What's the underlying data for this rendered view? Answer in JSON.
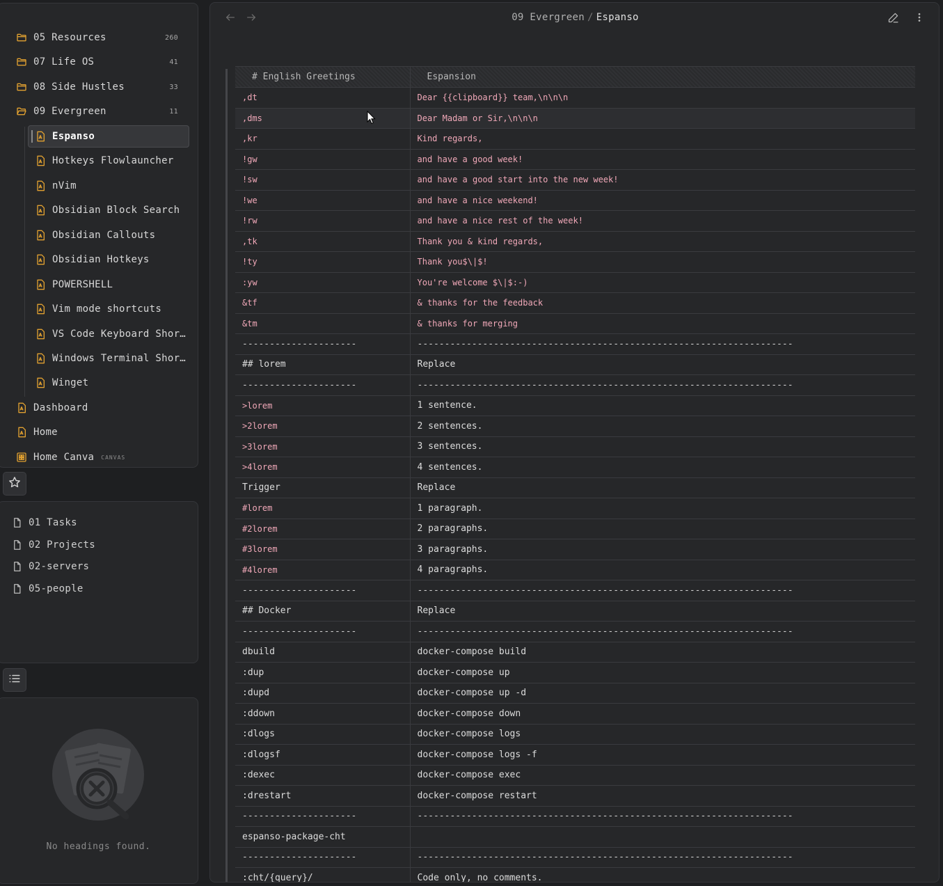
{
  "explorer": {
    "items": [
      {
        "label": "05 Resources",
        "count": "260",
        "type": "folder"
      },
      {
        "label": "07 Life OS",
        "count": "41",
        "type": "folder"
      },
      {
        "label": "08 Side Hustles",
        "count": "33",
        "type": "folder"
      },
      {
        "label": "09 Evergreen",
        "count": "11",
        "type": "folder-open"
      },
      {
        "label": "Espanso",
        "type": "file",
        "active": true
      },
      {
        "label": "Hotkeys Flowlauncher",
        "type": "file"
      },
      {
        "label": "nVim",
        "type": "file"
      },
      {
        "label": "Obsidian Block Search",
        "type": "file"
      },
      {
        "label": "Obsidian Callouts",
        "type": "file"
      },
      {
        "label": "Obsidian Hotkeys",
        "type": "file"
      },
      {
        "label": "POWERSHELL",
        "type": "file"
      },
      {
        "label": "Vim mode shortcuts",
        "type": "file"
      },
      {
        "label": "VS Code Keyboard Shor…",
        "type": "file"
      },
      {
        "label": "Windows Terminal Shor…",
        "type": "file"
      },
      {
        "label": "Winget",
        "type": "file"
      },
      {
        "label": "Dashboard",
        "type": "file"
      },
      {
        "label": "Home",
        "type": "file"
      },
      {
        "label": "Home Canva",
        "tag": "CANVAS",
        "type": "canvas"
      }
    ]
  },
  "bookmarks": {
    "items": [
      "01 Tasks",
      "02 Projects",
      "02-servers",
      "05-people"
    ]
  },
  "outline": {
    "empty_text": "No headings found."
  },
  "header": {
    "folder": "09 Evergreen",
    "separator": "/",
    "title": "Espanso"
  },
  "table": {
    "headers": [
      "# English Greetings",
      "Espansion"
    ],
    "rows": [
      {
        "k": ",dt",
        "v": "Dear {{clipboard}} team,\\n\\n\\n",
        "style": "code"
      },
      {
        "k": ",dms",
        "v": "Dear Madam or Sir,\\n\\n\\n",
        "style": "code",
        "hl": true
      },
      {
        "k": ",kr",
        "v": "Kind regards,",
        "style": "code"
      },
      {
        "k": "!gw",
        "v": "and have a good week!",
        "style": "code"
      },
      {
        "k": "!sw",
        "v": "and have a good start into the new week!",
        "style": "code"
      },
      {
        "k": "!we",
        "v": "and have a nice weekend!",
        "style": "code"
      },
      {
        "k": "!rw",
        "v": "and have a nice rest of the week!",
        "style": "code"
      },
      {
        "k": ",tk",
        "v": "Thank you & kind regards,",
        "style": "code"
      },
      {
        "k": "!ty",
        "v": "Thank you$\\|$!",
        "style": "code"
      },
      {
        "k": ":yw",
        "v": "You're welcome $\\|$:-)",
        "style": "code"
      },
      {
        "k": "&tf",
        "v": "& thanks for the feedback",
        "style": "code"
      },
      {
        "k": "&tm",
        "v": "& thanks for merging",
        "style": "code"
      },
      {
        "k": "---------------------",
        "v": "---------------------------------------------------------------------",
        "style": "dash"
      },
      {
        "k": "## lorem",
        "v": "Replace",
        "style": "plain"
      },
      {
        "k": "---------------------",
        "v": "---------------------------------------------------------------------",
        "style": "dash"
      },
      {
        "k": ">lorem",
        "v": "1 sentence.",
        "style": "kcode"
      },
      {
        "k": ">2lorem",
        "v": "2 sentences.",
        "style": "kcode"
      },
      {
        "k": ">3lorem",
        "v": "3 sentences.",
        "style": "kcode"
      },
      {
        "k": ">4lorem",
        "v": "4 sentences.",
        "style": "kcode"
      },
      {
        "k": "Trigger",
        "v": "Replace",
        "style": "plain"
      },
      {
        "k": "#lorem",
        "v": "1 paragraph.",
        "style": "kcode"
      },
      {
        "k": "#2lorem",
        "v": "2 paragraphs.",
        "style": "kcode"
      },
      {
        "k": "#3lorem",
        "v": "3 paragraphs.",
        "style": "kcode"
      },
      {
        "k": "#4lorem",
        "v": "4 paragraphs.",
        "style": "kcode"
      },
      {
        "k": "---------------------",
        "v": "---------------------------------------------------------------------",
        "style": "dash"
      },
      {
        "k": "## Docker",
        "v": "Replace",
        "style": "plain"
      },
      {
        "k": "---------------------",
        "v": "---------------------------------------------------------------------",
        "style": "dash"
      },
      {
        "k": "dbuild",
        "v": "docker-compose build",
        "style": "plain"
      },
      {
        "k": ":dup",
        "v": "docker-compose up",
        "style": "plain"
      },
      {
        "k": ":dupd",
        "v": "docker-compose up -d",
        "style": "plain"
      },
      {
        "k": ":ddown",
        "v": "docker-compose down",
        "style": "plain"
      },
      {
        "k": ":dlogs",
        "v": "docker-compose logs",
        "style": "plain"
      },
      {
        "k": ":dlogsf",
        "v": "docker-compose logs -f",
        "style": "plain"
      },
      {
        "k": ":dexec",
        "v": "docker-compose exec",
        "style": "plain"
      },
      {
        "k": ":drestart",
        "v": "docker-compose restart",
        "style": "plain"
      },
      {
        "k": "---------------------",
        "v": "---------------------------------------------------------------------",
        "style": "dash"
      },
      {
        "k": "espanso-package-cht",
        "v": "",
        "style": "plain"
      },
      {
        "k": "---------------------",
        "v": "---------------------------------------------------------------------",
        "style": "dash"
      },
      {
        "k": ":cht/{query}/",
        "v": "Code only, no comments.",
        "style": "plain"
      }
    ]
  },
  "colors": {
    "accent": "#e0a030",
    "code_text": "#f0a8b8",
    "background": "#1e1f21",
    "panel": "#262729"
  }
}
